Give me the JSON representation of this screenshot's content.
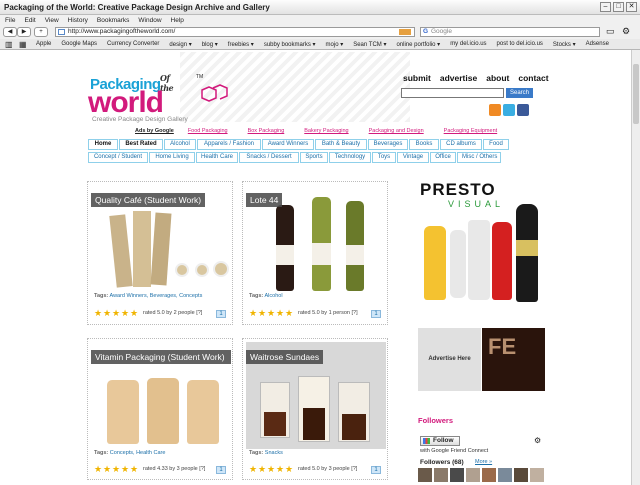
{
  "browser": {
    "title": "Packaging of the World: Creative Package Design Archive and Gallery",
    "menu": [
      "File",
      "Edit",
      "View",
      "History",
      "Bookmarks",
      "Window",
      "Help"
    ],
    "url": "http://www.packagingoftheworld.com/",
    "search_placeholder": "Google",
    "bookmarks": [
      "Apple",
      "Google Maps",
      "Currency Converter",
      "design ▾",
      "blog ▾",
      "freebies ▾",
      "subby bookmarks ▾",
      "mojo ▾",
      "Sean TCM ▾",
      "online portfolio ▾",
      "my del.icio.us",
      "post to del.icio.us",
      "Stocks ▾",
      "Adsense"
    ]
  },
  "site": {
    "logo_line1": "Packaging",
    "logo_of": "Of the",
    "logo_line2": "world",
    "logo_tm": "TM",
    "logo_tagline": "Creative Package Design Gallery",
    "topnav": [
      "submit",
      "advertise",
      "about",
      "contact"
    ],
    "search_button": "Search",
    "ads_label": "Ads by Google",
    "ad_links": [
      "Food Packaging",
      "Box Packaging",
      "Bakery Packaging",
      "Packaging and Design",
      "Packaging Equipment"
    ],
    "tabs_row1": [
      "Home",
      "Best Rated",
      "Alcohol",
      "Apparels / Fashion",
      "Award Winners",
      "Bath & Beauty",
      "Beverages",
      "Books",
      "CD albums",
      "Food"
    ],
    "tabs_row2": [
      "Concept / Student",
      "Home Living",
      "Health Care",
      "Snacks / Dessert",
      "Sports",
      "Technology",
      "Toys",
      "Vintage",
      "Office",
      "Misc / Others"
    ]
  },
  "posts": [
    {
      "caption": "Quality Café (Student Work)",
      "tags_label": "Tags:",
      "tags": "Award Winners, Beverages, Concepts",
      "rating": "rated 5.0 by 2 people [?]",
      "comments": "1"
    },
    {
      "caption": "Lote 44",
      "tags_label": "Tags:",
      "tags": "Alcohol",
      "rating": "rated 5.0 by 1 person [?]",
      "comments": "1"
    },
    {
      "caption": "Vitamin Packaging (Student Work)",
      "tags_label": "Tags:",
      "tags": "Concepts, Health Care",
      "rating": "rated 4.33 by 3 people [?]",
      "comments": "1"
    },
    {
      "caption": "Waitrose Sundaes",
      "tags_label": "Tags:",
      "tags": "Snacks",
      "rating": "rated 5.0 by 3 people [?]",
      "comments": "1"
    }
  ],
  "sidebar": {
    "presto": "PRESTO",
    "visual": "VISUAL",
    "advertise_here": "Advertise Here",
    "fe": "FE",
    "followers_title": "Followers",
    "follow_button": "Follow",
    "gfc": "with Google Friend Connect",
    "followers_count": "Followers (68)",
    "more": "More »"
  }
}
